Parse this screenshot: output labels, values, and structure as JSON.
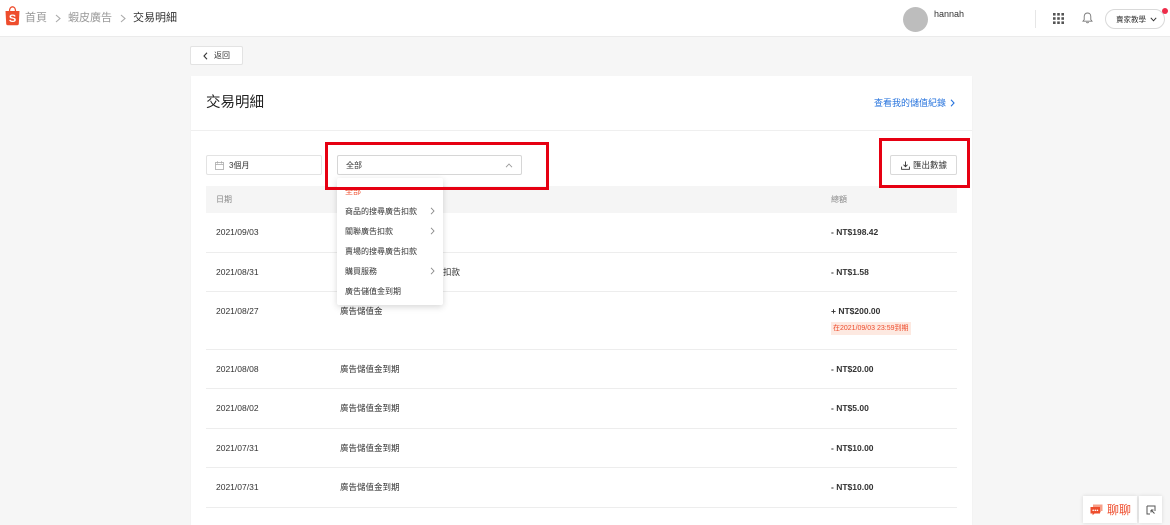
{
  "topbar": {
    "logo_letter": "S",
    "breadcrumb": [
      "首頁",
      "蝦皮廣告",
      "交易明細"
    ],
    "username": "hannah",
    "tutorial_label": "賣家教學",
    "has_notification_dot": true
  },
  "back_label": "返回",
  "page": {
    "title": "交易明細",
    "topup_history_link": "查看我的儲值紀錄"
  },
  "filters": {
    "date_range": "3個月",
    "type_selected": "全部",
    "type_dropdown_open": true,
    "export_label": "匯出數據"
  },
  "type_options": [
    {
      "label": "全部",
      "selected": true,
      "has_submenu": false
    },
    {
      "label": "商品的搜尋廣告扣款",
      "selected": false,
      "has_submenu": true
    },
    {
      "label": "關聯廣告扣款",
      "selected": false,
      "has_submenu": true
    },
    {
      "label": "賣場的搜尋廣告扣款",
      "selected": false,
      "has_submenu": false
    },
    {
      "label": "購買服務",
      "selected": false,
      "has_submenu": true
    },
    {
      "label": "廣告儲值金到期",
      "selected": false,
      "has_submenu": false
    }
  ],
  "table": {
    "headers": {
      "date": "日期",
      "total": "總額"
    },
    "rows": [
      {
        "date": "2021/09/03",
        "total": "- NT$198.42"
      },
      {
        "date": "2021/08/31",
        "description": "扣款",
        "total": "- NT$1.58"
      },
      {
        "date": "2021/08/27",
        "description": "廣告儲值金",
        "total": "+ NT$200.00",
        "expiry_note": "在2021/09/03 23:59到期"
      },
      {
        "date": "2021/08/08",
        "description": "廣告儲值金到期",
        "total": "- NT$20.00"
      },
      {
        "date": "2021/08/02",
        "description": "廣告儲值金到期",
        "total": "- NT$5.00"
      },
      {
        "date": "2021/07/31",
        "description": "廣告儲值金到期",
        "total": "- NT$10.00"
      },
      {
        "date": "2021/07/31",
        "description": "廣告儲值金到期",
        "total": "- NT$10.00"
      }
    ]
  },
  "chat": {
    "label": "聊聊"
  },
  "colors": {
    "brand": "#ee4d2d",
    "link": "#2673dd",
    "annotation_box": "#e60012",
    "text": "#333333",
    "muted": "#999999",
    "expiry_badge_bg": "#fde9e1"
  }
}
